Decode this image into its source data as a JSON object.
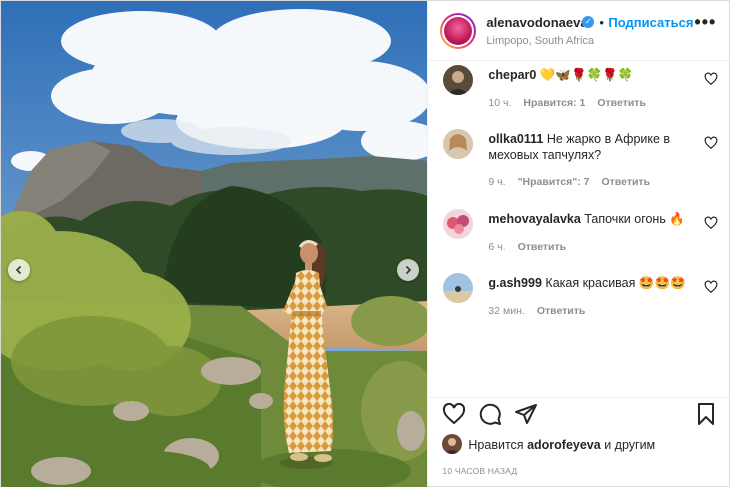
{
  "post": {
    "username": "alenavodonaeva",
    "verified_icon": "verified-badge-icon",
    "separator": "•",
    "follow_label": "Подписаться",
    "location": "Limpopo, South Africa",
    "more_label": "•••"
  },
  "comments": [
    {
      "user": "chepar0",
      "text": "💛🦋🌹🍀🌹🍀",
      "time": "10 ч.",
      "likes": "Нравится: 1",
      "reply": "Ответить"
    },
    {
      "user": "ollka0111",
      "text": "Не жарко в Африке в меховых тапчулях?",
      "time": "9 ч.",
      "likes": "\"Нравится\": 7",
      "reply": "Ответить"
    },
    {
      "user": "mehovayalavka",
      "text": "Тапочки огонь 🔥",
      "time": "6 ч.",
      "likes": "",
      "reply": "Ответить"
    },
    {
      "user": "g.ash999",
      "text": "Какая красивая 🤩🤩🤩",
      "time": "32 мин.",
      "likes": "",
      "reply": "Ответить"
    }
  ],
  "likes_line": {
    "prefix": "Нравится",
    "user": "adorofeyeva",
    "suffix": "и другим"
  },
  "timestamp": "10 ЧАСОВ НАЗАД",
  "colors": {
    "follow": "#0095f6",
    "verified": "#3897f0",
    "meta": "#8e8e8e"
  }
}
